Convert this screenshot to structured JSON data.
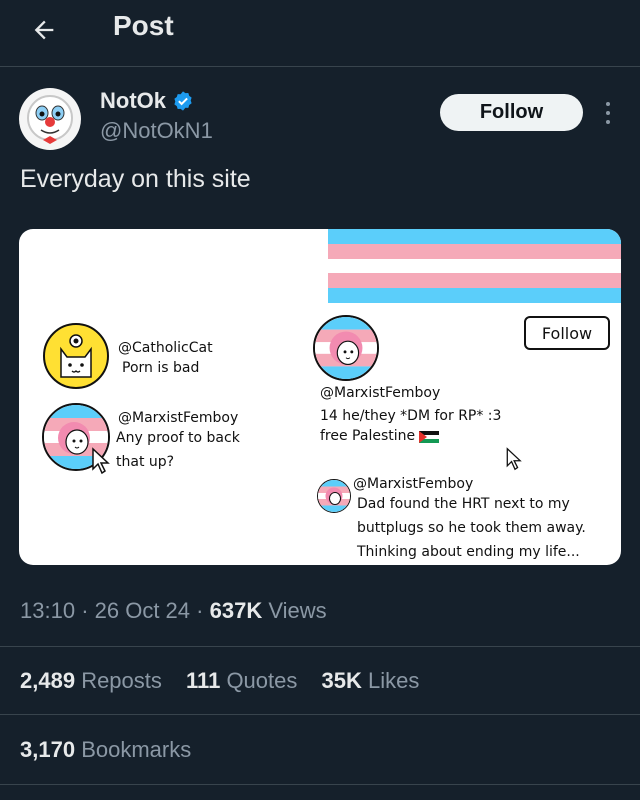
{
  "header": {
    "title": "Post"
  },
  "author": {
    "name": "NotOk",
    "handle": "@NotOkN1",
    "follow_label": "Follow"
  },
  "tweet": {
    "text": "Everyday on this site"
  },
  "media": {
    "left_top": {
      "handle": "@CatholicCat",
      "text": "Porn is bad"
    },
    "left_bottom": {
      "handle": "@MarxistFemboy",
      "line1": "Any proof to back",
      "line2": "that up?"
    },
    "profile": {
      "follow_label": "Follow",
      "handle": "@MarxistFemboy",
      "bio1": "14 he/they *DM for RP* :3",
      "bio2": "free Palestine"
    },
    "reply": {
      "handle": "@MarxistFemboy",
      "line1": "Dad found the HRT next to my",
      "line2": "buttplugs so he took them away.",
      "line3": "Thinking about ending my life..."
    },
    "flag_colors": [
      "#5bcefa",
      "#f5a9b8",
      "#ffffff",
      "#f5a9b8",
      "#5bcefa"
    ]
  },
  "meta": {
    "time": "13:10",
    "date": "26 Oct 24",
    "views_count": "637K",
    "views_label": "Views"
  },
  "stats": {
    "reposts_count": "2,489",
    "reposts_label": "Reposts",
    "quotes_count": "111",
    "quotes_label": "Quotes",
    "likes_count": "35K",
    "likes_label": "Likes",
    "bookmarks_count": "3,170",
    "bookmarks_label": "Bookmarks"
  },
  "colors": {
    "background": "#15202b",
    "text": "#e7e9ea",
    "secondary": "#8b98a5",
    "verified": "#1d9bf0"
  }
}
